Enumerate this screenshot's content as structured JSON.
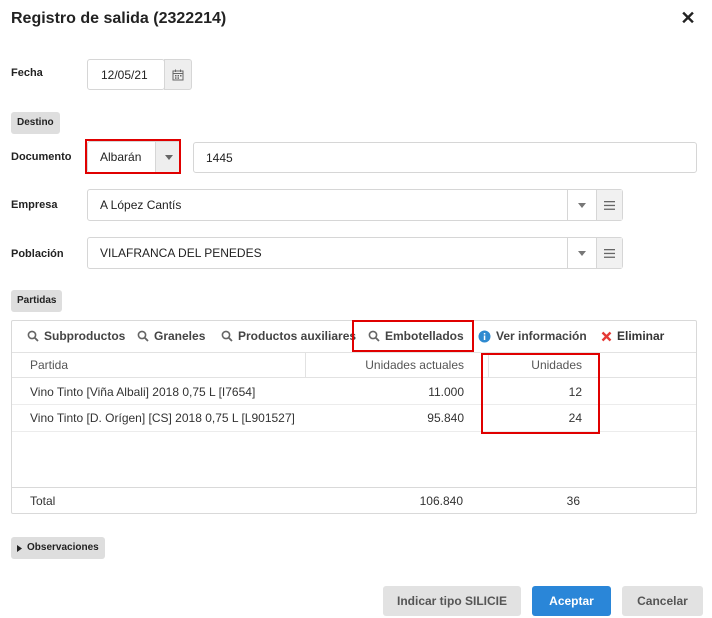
{
  "dialog": {
    "title": "Registro de salida (2322214)"
  },
  "fecha": {
    "label": "Fecha",
    "value": "12/05/21"
  },
  "sections": {
    "destino": "Destino",
    "partidas": "Partidas",
    "observaciones": "Observaciones"
  },
  "documento": {
    "label": "Documento",
    "type": "Albarán",
    "number": "1445"
  },
  "empresa": {
    "label": "Empresa",
    "value": "A López Cantís"
  },
  "poblacion": {
    "label": "Población",
    "value": "VILAFRANCA DEL PENEDES"
  },
  "toolbar": {
    "subproductos": "Subproductos",
    "graneles": "Graneles",
    "auxiliares": "Productos auxiliares",
    "embotellados": "Embotellados",
    "ver_info": "Ver información",
    "eliminar": "Eliminar"
  },
  "table": {
    "headers": {
      "partida": "Partida",
      "actuales": "Unidades actuales",
      "unidades": "Unidades"
    },
    "rows": [
      {
        "partida": "Vino Tinto [Viña Albali] 2018 0,75 L [I7654]",
        "actuales": "11.000",
        "unidades": "12"
      },
      {
        "partida": "Vino Tinto [D. Orígen] [CS] 2018 0,75 L [L901527]",
        "actuales": "95.840",
        "unidades": "24"
      }
    ],
    "total": {
      "label": "Total",
      "actuales": "106.840",
      "unidades": "36"
    }
  },
  "buttons": {
    "silicie": "Indicar tipo SILICIE",
    "aceptar": "Aceptar",
    "cancelar": "Cancelar"
  },
  "colors": {
    "primary": "#2a86d8",
    "highlight": "#e00000",
    "info": "#2f8ad0",
    "danger": "#e53935"
  }
}
